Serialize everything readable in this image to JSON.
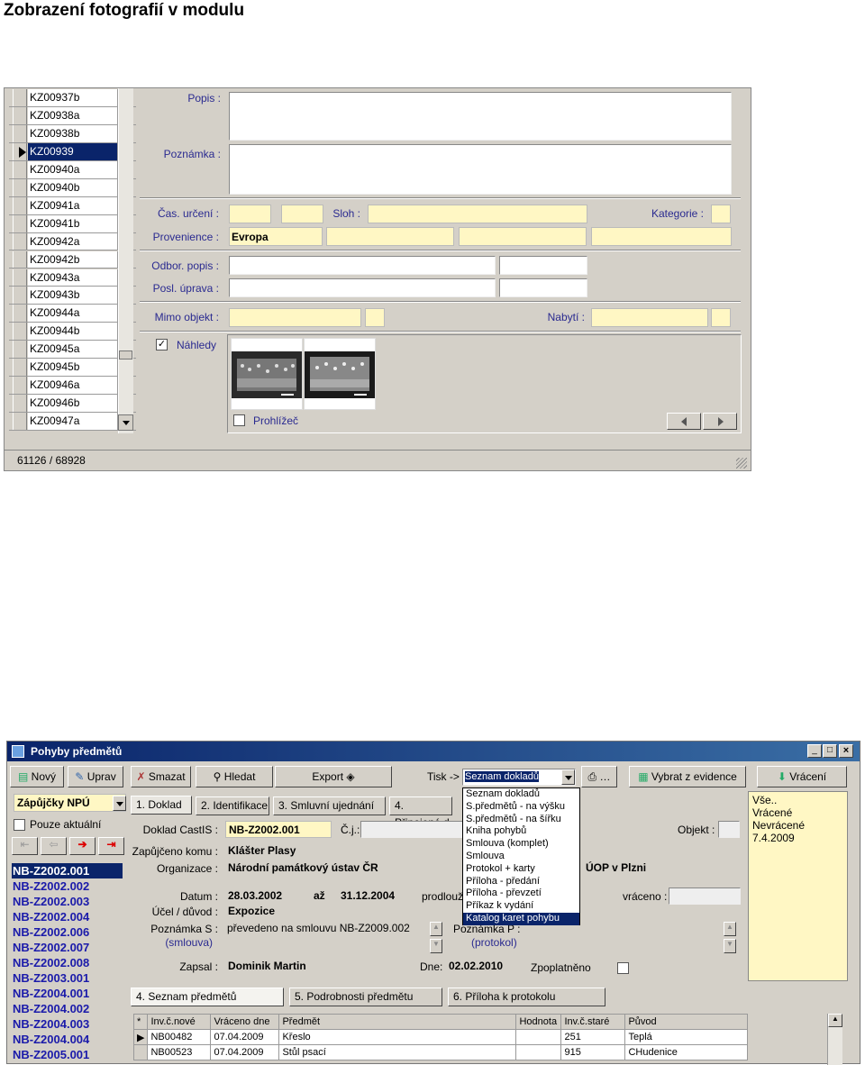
{
  "heading": "Zobrazení fotografií  v modulu",
  "win1": {
    "list_items": [
      "KZ00937b",
      "KZ00938a",
      "KZ00938b",
      "KZ00939",
      "KZ00940a",
      "KZ00940b",
      "KZ00941a",
      "KZ00941b",
      "KZ00942a",
      "KZ00942b",
      "KZ00943a",
      "KZ00943b",
      "KZ00944a",
      "KZ00944b",
      "KZ00945a",
      "KZ00945b",
      "KZ00946a",
      "KZ00946b",
      "KZ00947a"
    ],
    "selected_index": 3,
    "labels": {
      "popis": "Popis :",
      "poznamka": "Poznámka :",
      "cas_urceni": "Čas. určení :",
      "sloh": "Sloh :",
      "kategorie": "Kategorie :",
      "provenience": "Provenience :",
      "odbor_popis": "Odbor. popis :",
      "posl_uprava": "Posl. úprava :",
      "mimo_objekt": "Mimo objekt :",
      "nabyti": "Nabytí :",
      "nahledy": "Náhledy",
      "prohlizec": "Prohlížeč"
    },
    "provenience_value": "Evropa",
    "nahledy_checked": true,
    "prohlizec_checked": false,
    "status": "61126 / 68928"
  },
  "win2": {
    "title": "Pohyby předmětů",
    "toolbar": {
      "novy": "Nový",
      "uprav": "Uprav",
      "smazat": "Smazat",
      "hledat": "Hledat",
      "export": "Export",
      "tisk": "Tisk ->",
      "tisk_selected": "Seznam dokladů",
      "vybrat": "Vybrat z evidence",
      "vraceni": "Vrácení"
    },
    "dropdown_options": [
      "Seznam dokladů",
      "S.předmětů - na výšku",
      "S.předmětů - na šířku",
      "Kniha pohybů",
      "Smlouva (komplet)",
      "Smlouva",
      "Protokol + karty",
      "Příloha - předání",
      "Příloha - převzetí",
      "Příkaz k vydání",
      "Katalog karet pohybu"
    ],
    "dropdown_highlight": 10,
    "filter_select": "Zápůjčky NPÚ",
    "pouze_aktualni": "Pouze aktuální",
    "nb_list": [
      "NB-Z2002.001",
      "NB-Z2002.002",
      "NB-Z2002.003",
      "NB-Z2002.004",
      "NB-Z2002.006",
      "NB-Z2002.007",
      "NB-Z2002.008",
      "NB-Z2003.001",
      "NB-Z2004.001",
      "NB-Z2004.002",
      "NB-Z2004.003",
      "NB-Z2004.004",
      "NB-Z2005.001"
    ],
    "tabs": [
      "1. Doklad",
      "2. Identifikace",
      "3. Smluvní ujednání",
      "4. Připojené d"
    ],
    "right_list": [
      "Vše..",
      "Vrácené",
      "Nevrácené",
      "7.4.2009"
    ],
    "form": {
      "doklad_label": "Doklad CastIS :",
      "doklad_value": "NB-Z2002.001",
      "cj_label": "Č.j.:",
      "objekt_label": "Objekt :",
      "zapujceno_label": "Zapůjčeno komu :",
      "zapujceno_value": "Klášter Plasy",
      "organizace_label": "Organizace :",
      "organizace_value": "Národní památkový ústav ČR",
      "organizace_value2": "ÚOP v Plzni",
      "datum_label": "Datum :",
      "datum_from": "28.03.2002",
      "az": "až",
      "datum_to": "31.12.2004",
      "prodlouzeni": "prodlouž",
      "vraceno_label": "vráceno :",
      "ucel_label": "Účel / důvod :",
      "ucel_value": "Expozice",
      "poznamka_s_label": "Poznámka S :",
      "smlouva_label": "(smlouva)",
      "poznamka_s_value": "převedeno na smlouvu NB-Z2009.002",
      "poznamka_p_label": "Poznámka P :",
      "protokol_label": "(protokol)",
      "zapsal_label": "Zapsal :",
      "zapsal_value": "Dominik Martin",
      "dne_label": "Dne:",
      "dne_value": "02.02.2010",
      "zpoplatneno": "Zpoplatněno"
    },
    "bottom_tabs": [
      "4. Seznam předmětů",
      "5. Podrobnosti předmětu",
      "6. Příloha k protokolu"
    ],
    "grid": {
      "headers": [
        "*",
        "Inv.č.nové",
        "Vráceno dne",
        "Předmět",
        "Hodnota",
        "Inv.č.staré",
        "Původ"
      ],
      "rows": [
        [
          "",
          "NB00482",
          "07.04.2009",
          "Křeslo",
          "",
          "251",
          "Teplá"
        ],
        [
          "",
          "NB00523",
          "07.04.2009",
          "Stůl psací",
          "",
          "915",
          "CHudenice"
        ]
      ]
    }
  }
}
